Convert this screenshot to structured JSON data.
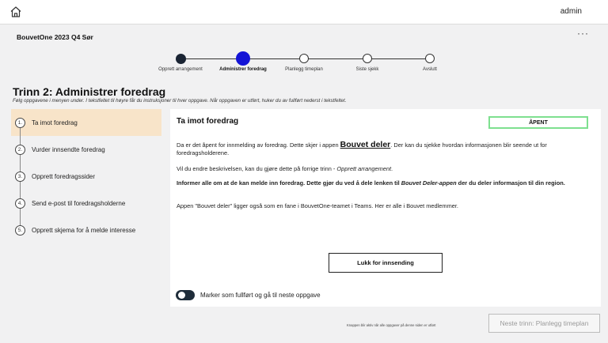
{
  "header": {
    "user": "admin"
  },
  "event": {
    "title": "BouvetOne 2023 Q4 Sør"
  },
  "steps": [
    {
      "label": "Opprett arrangement",
      "state": "done"
    },
    {
      "label": "Administrer foredrag",
      "state": "current"
    },
    {
      "label": "Planlegg timeplan",
      "state": "todo"
    },
    {
      "label": "Siste sjekk",
      "state": "todo"
    },
    {
      "label": "Avslutt",
      "state": "todo"
    }
  ],
  "page": {
    "title": "Trinn 2: Administrer foredrag",
    "instruction": "Følg oppgavene i menyen under. I tekstfeltet til høyre får du instruksjoner til hver oppgave. Når oppgaven er utført, huker du av fullført nederst i tekstfeltet."
  },
  "tasks": [
    {
      "num": "1.",
      "label": "Ta imot foredrag"
    },
    {
      "num": "2.",
      "label": "Vurder innsendte foredrag"
    },
    {
      "num": "3.",
      "label": "Opprett foredragssider"
    },
    {
      "num": "4.",
      "label": "Send e-post til foredragsholderne"
    },
    {
      "num": "5.",
      "label": "Opprett skjema for å melde interesse"
    }
  ],
  "panel": {
    "title": "Ta imot foredrag",
    "status": "ÅPENT",
    "p1_before": "Da er det åpent for innmelding av foredrag. Dette skjer i appen ",
    "p1_link": "Bouvet deler",
    "p1_after": ". Der kan du sjekke hvordan informasjonen blir seende ut for foredragsholderene.",
    "p2_before": "Vil du endre beskrivelsen, kan du gjøre dette på forrige trinn - ",
    "p2_italic": "Opprett arrangement",
    "p2_after": ".",
    "p3_before": "Informer alle om at de kan melde inn foredrag. Dette gjør du ved å dele lenken til ",
    "p3_italic": "Bouvet Deler-appen",
    "p3_after": " der du deler informasjon til din region.",
    "p4": "Appen \"Bouvet deler\" ligger også som en fane i BouvetOne-teamet i Teams. Her er alle i Bouvet medlemmer.",
    "close_button": "Lukk for innsending",
    "toggle_label": "Marker som fullført og gå til neste oppgave"
  },
  "footer": {
    "note": "Knappen blir aktiv når alle oppgaver på denne siden er utført",
    "next_button": "Neste trinn: Planlegg timeplan"
  },
  "colors": {
    "accent": "#1414d6",
    "active_task": "#f8e4c9",
    "status_border": "#7ee08f",
    "toggle": "#1f2d3a"
  }
}
